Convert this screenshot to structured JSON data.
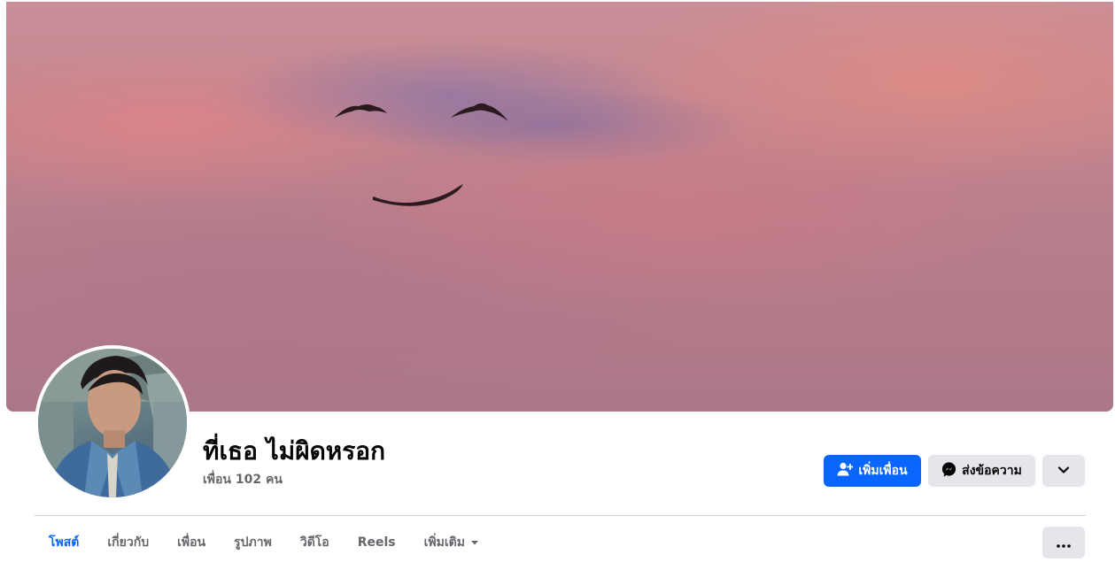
{
  "profile": {
    "name": "ที่เธอ ไม่ผิดหรอก",
    "friends_text": "เพื่อน 102 คน"
  },
  "actions": {
    "add_friend": "เพิ่มเพื่อน",
    "message": "ส่งข้อความ"
  },
  "tabs": [
    {
      "label": "โพสต์",
      "active": true
    },
    {
      "label": "เกี่ยวกับ",
      "active": false
    },
    {
      "label": "เพื่อน",
      "active": false
    },
    {
      "label": "รูปภาพ",
      "active": false
    },
    {
      "label": "วิดีโอ",
      "active": false
    },
    {
      "label": "Reels",
      "active": false
    },
    {
      "label": "เพิ่มเติม",
      "active": false
    }
  ],
  "icons": {
    "add_friend": "person-plus-icon",
    "message": "messenger-icon",
    "chevron": "chevron-down-icon",
    "more": "ellipsis-icon",
    "tab_dropdown": "caret-down-icon"
  },
  "colors": {
    "accent": "#0866ff",
    "secondary_bg": "#e4e6eb",
    "muted_text": "#65676b"
  }
}
